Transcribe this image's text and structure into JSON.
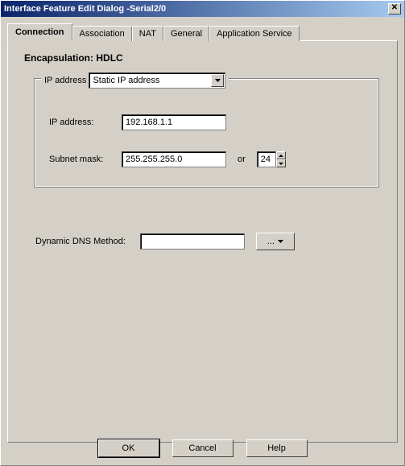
{
  "window": {
    "title": "Interface Feature Edit Dialog -Serial2/0",
    "close_glyph": "✕"
  },
  "tabs": [
    {
      "label": "Connection",
      "active": true
    },
    {
      "label": "Association",
      "active": false
    },
    {
      "label": "NAT",
      "active": false
    },
    {
      "label": "General",
      "active": false
    },
    {
      "label": "Application Service",
      "active": false
    }
  ],
  "encapsulation": {
    "label": "Encapsulation:",
    "value": "HDLC"
  },
  "ip_group": {
    "legend": "IP address",
    "mode_selected": "Static IP address",
    "ip_label": "IP address:",
    "ip_value": "192.168.1.1",
    "subnet_label": "Subnet mask:",
    "subnet_value": "255.255.255.0",
    "or_label": "or",
    "prefix_value": "24"
  },
  "dns": {
    "label": "Dynamic DNS Method:",
    "value": "",
    "menu_label": "..."
  },
  "buttons": {
    "ok": "OK",
    "cancel": "Cancel",
    "help": "Help"
  }
}
